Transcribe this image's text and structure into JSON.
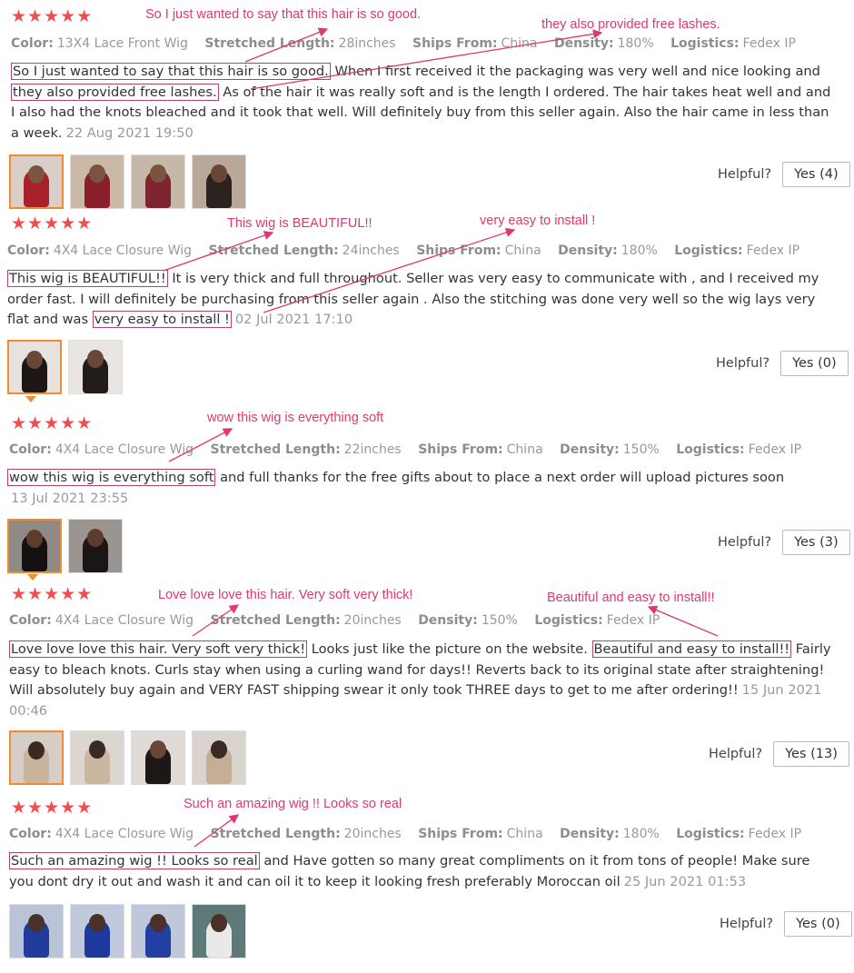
{
  "helpful_label": "Helpful?",
  "annotation_color": "#e1386e",
  "star_color": "#f04e4e",
  "reviews": [
    {
      "stars": "★★★★★",
      "meta": {
        "color_k": "Color:",
        "color_v": "13X4 Lace Front Wig",
        "length_k": "Stretched Length:",
        "length_v": "28inches",
        "ships_k": "Ships From:",
        "ships_v": "China",
        "density_k": "Density:",
        "density_v": "180%",
        "logistics_k": "Logistics:",
        "logistics_v": "Fedex IP"
      },
      "parts": [
        "So I just wanted to say that this hair is so good.",
        " When I first received it the packaging was very well and nice looking and ",
        "they also provided free lashes.",
        " As of the hair it was really soft and is the length I ordered. The hair takes heat well and and I also had the knots bleached and it took that well. Will definitely buy from this seller again. Also the hair came in less than a week."
      ],
      "date": "22 Aug 2021 19:50",
      "helpful_button": "Yes (4)",
      "annotations": [
        "So I just wanted to say that this hair is so good.",
        "they also provided free lashes."
      ]
    },
    {
      "stars": "★★★★★",
      "meta": {
        "color_k": "Color:",
        "color_v": "4X4 Lace Closure Wig",
        "length_k": "Stretched Length:",
        "length_v": "24inches",
        "ships_k": "Ships From:",
        "ships_v": "China",
        "density_k": "Density:",
        "density_v": "180%",
        "logistics_k": "Logistics:",
        "logistics_v": "Fedex IP"
      },
      "parts": [
        "This wig is BEAUTIFUL!!",
        " It is very thick and full throughout. Seller was very easy to communicate with , and I received my order fast. I will definitely be purchasing from this seller again . Also the stitching was done very well so the wig lays very flat and was ",
        "very easy to install !"
      ],
      "date": "02 Jul 2021 17:10",
      "helpful_button": "Yes (0)",
      "annotations": [
        "This wig is BEAUTIFUL!!",
        "very easy to install !"
      ]
    },
    {
      "stars": "★★★★★",
      "meta": {
        "color_k": "Color:",
        "color_v": "4X4 Lace Closure Wig",
        "length_k": "Stretched Length:",
        "length_v": "22inches",
        "ships_k": "Ships From:",
        "ships_v": "China",
        "density_k": "Density:",
        "density_v": "150%",
        "logistics_k": "Logistics:",
        "logistics_v": "Fedex IP"
      },
      "parts": [
        "wow this wig is everything soft",
        " and full thanks for the free gifts about to place a next order will upload pictures soon"
      ],
      "date": "13 Jul 2021 23:55",
      "helpful_button": "Yes (3)",
      "annotations": [
        "wow this wig is everything soft"
      ]
    },
    {
      "stars": "★★★★★",
      "meta": {
        "color_k": "Color:",
        "color_v": "4X4 Lace Closure Wig",
        "length_k": "Stretched Length:",
        "length_v": "20inches",
        "density_k": "Density:",
        "density_v": "150%",
        "logistics_k": "Logistics:",
        "logistics_v": "Fedex IP"
      },
      "parts": [
        "Love love love this hair. Very soft very thick!",
        " Looks just like the picture on the website. ",
        "Beautiful and easy to install!!",
        " Fairly easy to bleach knots. Curls stay when using a curling wand for days!! Reverts back to its original state after straightening! Will absolutely buy again and VERY FAST shipping swear it only took THREE days to get to me after ordering!!"
      ],
      "date": "15 Jun 2021 00:46",
      "helpful_button": "Yes (13)",
      "annotations": [
        "Love love love this hair. Very soft very thick!",
        "Beautiful and easy to install!!"
      ]
    },
    {
      "stars": "★★★★★",
      "meta": {
        "color_k": "Color:",
        "color_v": "4X4 Lace Closure Wig",
        "length_k": "Stretched Length:",
        "length_v": "20inches",
        "ships_k": "Ships From:",
        "ships_v": "China",
        "density_k": "Density:",
        "density_v": "180%",
        "logistics_k": "Logistics:",
        "logistics_v": "Fedex IP"
      },
      "parts": [
        "Such an amazing wig !! Looks so real",
        " and Have gotten so many great compliments on it from tons of people! Make sure you dont dry it out and wash it and can oil it to keep it looking fresh preferably Moroccan oil"
      ],
      "date": "25 Jun 2021 01:53",
      "helpful_button": "Yes (0)",
      "annotations": [
        "Such an amazing wig !! Looks so real"
      ]
    }
  ]
}
